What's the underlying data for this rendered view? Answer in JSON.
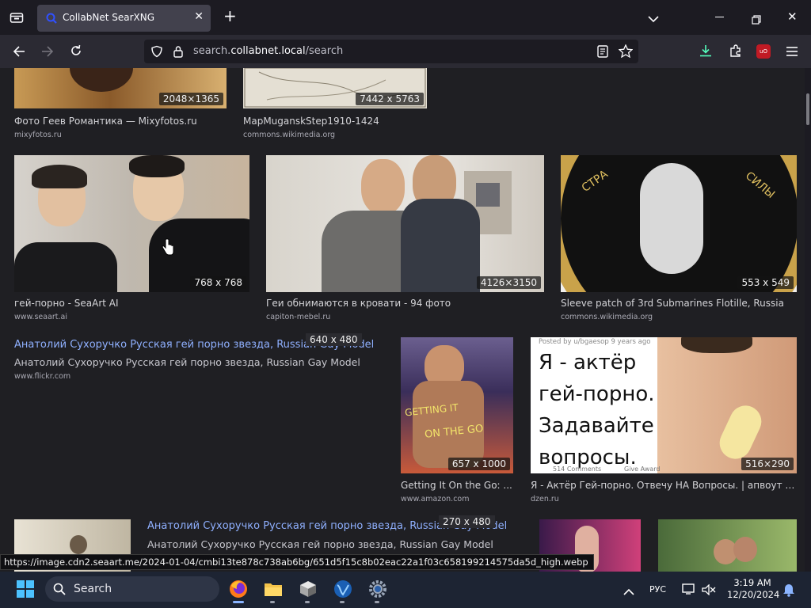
{
  "browser": {
    "tab_title": "CollabNet SearXNG",
    "url_host_prefix": "search.",
    "url_host": "collabnet.local",
    "url_path": "/search",
    "status_url": "https://image.cdn2.seaart.me/2024-01-04/cmbi13te878c738ab6bg/651d5f15c8b02eac22a1f03c658199214575da5d_high.webp"
  },
  "results": {
    "row1": [
      {
        "caption": "Фото Геев Романтика — Mixyfotos.ru",
        "source": "mixyfotos.ru",
        "dims": "2048×1365"
      },
      {
        "caption": "MapMuganskStep1910-1424",
        "source": "commons.wikimedia.org",
        "dims": "7442 x 5763"
      }
    ],
    "row2": [
      {
        "caption": "гей-порно - SeaArt AI",
        "source": "www.seaart.ai",
        "dims": "768 x 768"
      },
      {
        "caption": "Геи обнимаются в кровати - 94 фото",
        "source": "capiton-mebel.ru",
        "dims": "4126×3150"
      },
      {
        "caption": "Sleeve patch of 3rd Submarines Flotille, Russia",
        "source": "commons.wikimedia.org",
        "dims": "553 x 549"
      }
    ],
    "text_result_1": {
      "title": "Анатолий Сухоручко Русская гей порно звезда, Russian Gay Model",
      "subtitle": "Анатолий Сухоручко Русская гей порно звезда, Russian Gay Model",
      "source": "www.flickr.com",
      "dims": "640 x 480"
    },
    "row3": [
      {
        "caption": "Getting It On the Go: ...",
        "source": "www.amazon.com",
        "dims": "657 x 1000",
        "cover_text_1": "GETTING IT",
        "cover_text_2": "ON THE GO"
      },
      {
        "caption": "Я - Актёр Гей-порно. Отвечу НА Вопросы. | апвоут | Д...",
        "source": "dzen.ru",
        "dims": "516×290",
        "posted": "Posted by u/bgaesop 9 years ago",
        "overlay_lines": [
          "Я - актёр",
          "гей-порно.",
          "Задавайте",
          "вопросы."
        ],
        "comments": "514 Comments",
        "award": "Give Award"
      }
    ],
    "text_result_2": {
      "title": "Анатолий Сухоручко Русская гей порно звезда, Russian Gay Model",
      "subtitle": "Анатолий Сухоручко Русская гей порно звезда, Russian Gay Model",
      "dims": "270 x 480"
    },
    "patch_text_left": "СТРА",
    "patch_text_right": "СИЛЫ"
  },
  "taskbar": {
    "search_label": "Search",
    "language": "РУС",
    "time": "3:19 AM",
    "date": "12/20/2024"
  },
  "colors": {
    "accent": "#8ab4ff",
    "link": "#8fb0ff"
  }
}
